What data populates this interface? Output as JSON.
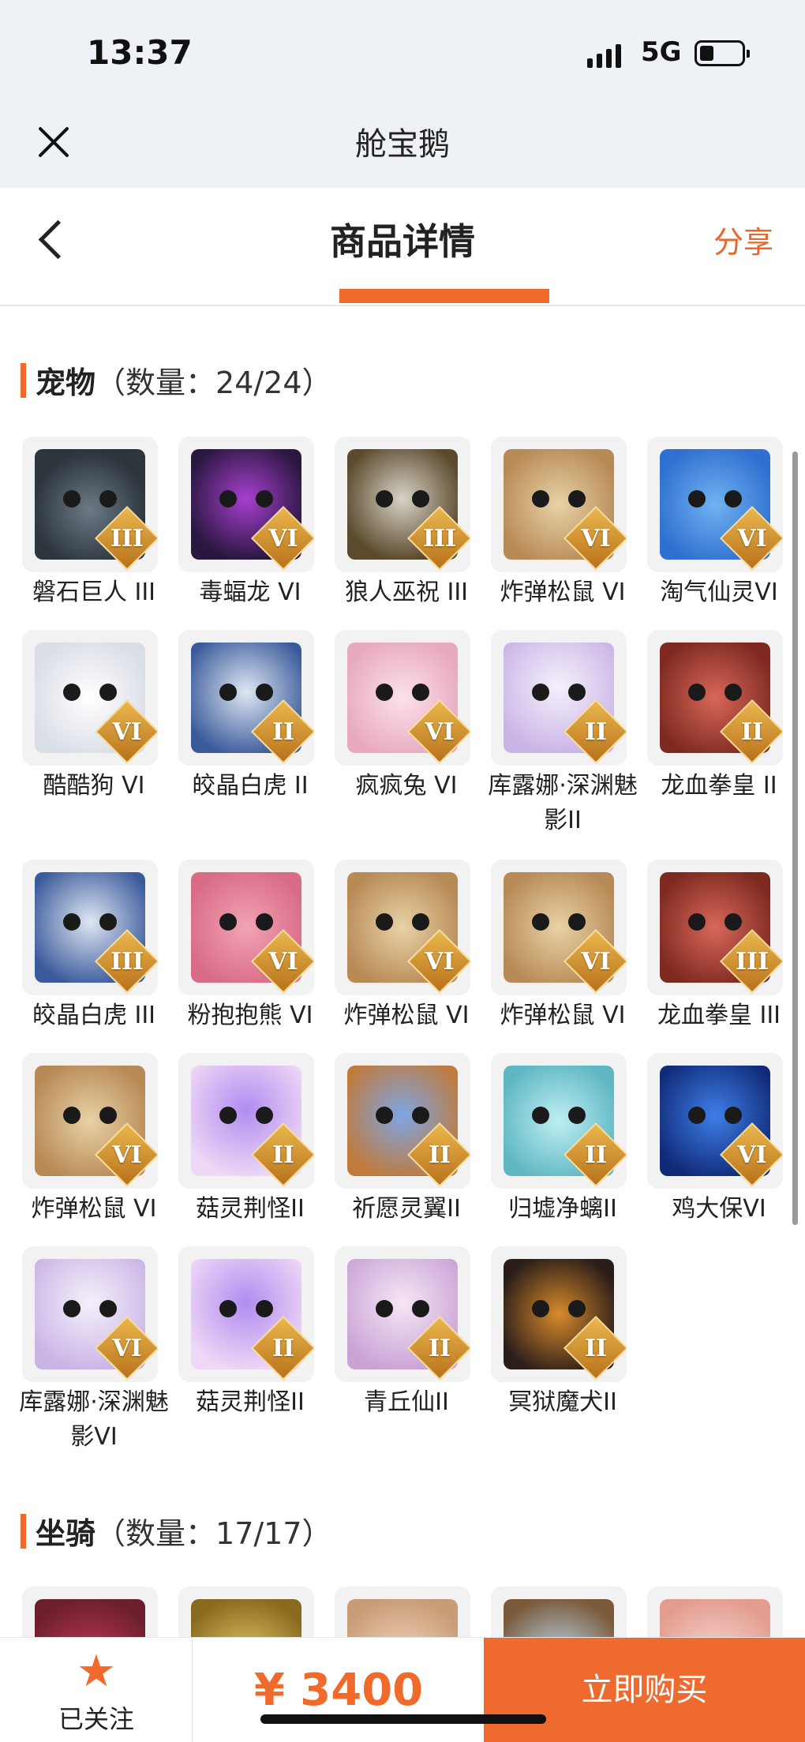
{
  "status_bar": {
    "time": "13:37",
    "network": "5G"
  },
  "miniapp": {
    "title": "舱宝鹅"
  },
  "header": {
    "title": "商品详情",
    "share_label": "分享"
  },
  "pets_section": {
    "name": "宠物",
    "count": "（数量：24/24）",
    "items": [
      {
        "label": "磐石巨人 III",
        "rank": "III",
        "art": "c-rock"
      },
      {
        "label": "毒蝠龙 VI",
        "rank": "VI",
        "art": "c-bat"
      },
      {
        "label": "狼人巫祝 III",
        "rank": "III",
        "art": "c-wolf"
      },
      {
        "label": "炸弹松鼠 VI",
        "rank": "VI",
        "art": "c-squirrel"
      },
      {
        "label": "淘气仙灵VI",
        "rank": "VI",
        "art": "c-sprite"
      },
      {
        "label": "酷酷狗 VI",
        "rank": "VI",
        "art": "c-dog"
      },
      {
        "label": "皎晶白虎 II",
        "rank": "II",
        "art": "c-tiger"
      },
      {
        "label": "疯疯兔 VI",
        "rank": "VI",
        "art": "c-rabbit"
      },
      {
        "label": "库露娜·深渊魅影II",
        "rank": "II",
        "art": "c-kuluna"
      },
      {
        "label": "龙血拳皇 II",
        "rank": "II",
        "art": "c-dragon"
      },
      {
        "label": "皎晶白虎 III",
        "rank": "III",
        "art": "c-tiger"
      },
      {
        "label": "粉抱抱熊 VI",
        "rank": "VI",
        "art": "c-bear"
      },
      {
        "label": "炸弹松鼠 VI",
        "rank": "VI",
        "art": "c-squirrel"
      },
      {
        "label": "炸弹松鼠 VI",
        "rank": "VI",
        "art": "c-squirrel"
      },
      {
        "label": "龙血拳皇 III",
        "rank": "III",
        "art": "c-dragon"
      },
      {
        "label": "炸弹松鼠 VI",
        "rank": "VI",
        "art": "c-squirrel"
      },
      {
        "label": "菇灵荆怪II",
        "rank": "II",
        "art": "c-mush"
      },
      {
        "label": "祈愿灵翼II",
        "rank": "II",
        "art": "c-wing"
      },
      {
        "label": "归墟净螭II",
        "rank": "II",
        "art": "c-jiao"
      },
      {
        "label": "鸡大保VI",
        "rank": "VI",
        "art": "c-chick"
      },
      {
        "label": "库露娜·深渊魅影VI",
        "rank": "VI",
        "art": "c-kuluna"
      },
      {
        "label": "菇灵荆怪II",
        "rank": "II",
        "art": "c-mush"
      },
      {
        "label": "青丘仙II",
        "rank": "II",
        "art": "c-fox"
      },
      {
        "label": "冥狱魔犬II",
        "rank": "II",
        "art": "c-hound"
      }
    ]
  },
  "mounts_section": {
    "name": "坐骑",
    "count": "（数量：17/17）",
    "items": [
      {
        "art": "c-mount1"
      },
      {
        "art": "c-mount2"
      },
      {
        "art": "c-mount3"
      },
      {
        "art": "c-mount4"
      },
      {
        "art": "c-mount5"
      }
    ]
  },
  "bottom_bar": {
    "follow_label": "已关注",
    "star_icon": "star-icon",
    "price": "¥ 3400",
    "buy_label": "立即购买"
  },
  "colors": {
    "accent": "#f06a2c",
    "rank_badge": "#d99a34"
  }
}
